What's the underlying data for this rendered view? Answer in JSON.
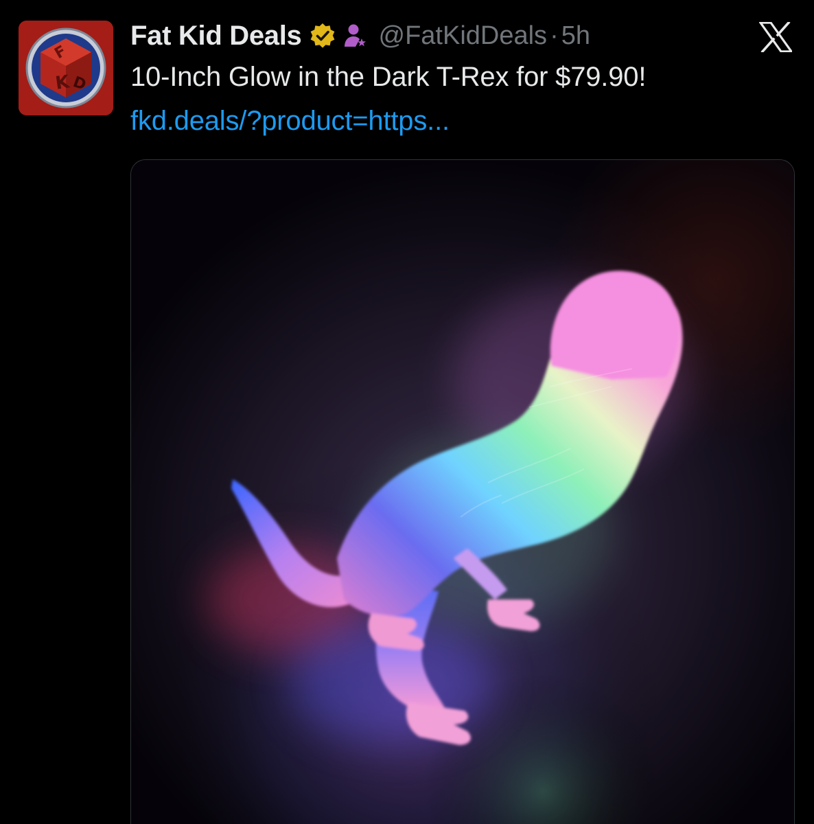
{
  "post": {
    "author": {
      "display_name": "Fat Kid Deals",
      "handle": "@FatKidDeals",
      "avatar_label": "FKD",
      "verified_badge": "verified-checkmark-gold",
      "affiliate_badge": "affiliate-icon"
    },
    "separator": "·",
    "timestamp": "5h",
    "text": "10-Inch Glow in the Dark T-Rex for $79.90!",
    "link": "fkd.deals/?product=https...",
    "media": {
      "type": "photo",
      "subject": "glow-in-the-dark t-rex toy"
    },
    "platform_icon": "x-logo-icon"
  },
  "colors": {
    "background": "#000000",
    "text_primary": "#e7e9ea",
    "text_secondary": "#71767b",
    "link": "#1d9bf0",
    "verified_gold": "#e2b719",
    "affiliate_purple": "#b05cc9",
    "avatar_red": "#a41d17"
  }
}
